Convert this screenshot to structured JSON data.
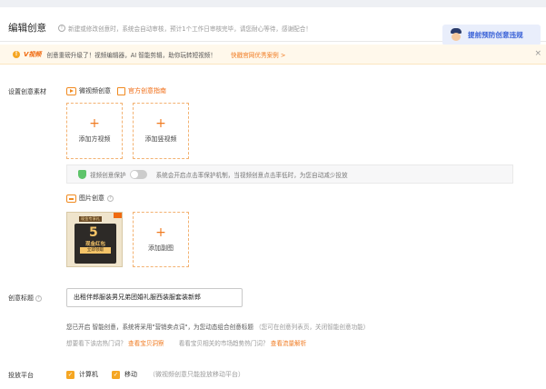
{
  "header": {
    "title": "编辑创意",
    "info_icon": "info-circle-icon",
    "info": "新建或修改创意时，系统会自动审核，预计1个工作日审核完毕，请您耐心等待，感谢配合！",
    "button_label": "提前预防创意违规",
    "button_icon": "police-avatar-icon"
  },
  "banner": {
    "icon": "warning-icon",
    "brand": "V视频",
    "text": "创意重磅升级了！视频编辑器，AI 智能剪辑，助你玩转短视频！",
    "link": "快戳官网优秀案例 >",
    "close": "×"
  },
  "creative_material": {
    "label": "设置创意素材",
    "video_tab": "微视频创意",
    "guide_link": "官方创意指南",
    "add_square_video": "添加方视频",
    "add_vertical_video": "添加竖视频",
    "protect_label": "视频创意保护",
    "protect_desc": "系统会开启点击率保护机制，当视频创意点击率低时，为您自动减少投放",
    "image_label": "图片创意",
    "thumb_tag": "现金专享礼",
    "thumb_number": "5",
    "thumb_title": "现金红包",
    "thumb_btn": "立即领取",
    "add_image": "添加副图"
  },
  "creative_title": {
    "label": "创意标题",
    "value": "出租伴郎服装男兄弟团婚礼服西装服套装新郎",
    "smart_note": "您已开启 智能创意，系统将采用\"营销卖点词\"，为您动态组合创意标题",
    "smart_hint": "（您可在创意列表页，关闭智能创意功能）",
    "hot_q1": "想要看下该店热门词？",
    "hot_link1": "查看宝贝洞察",
    "hot_q2": "看看宝贝相关的市场趋势热门词？",
    "hot_link2": "查看流量解析"
  },
  "platform": {
    "label": "投放平台",
    "option1": "计算机",
    "option2": "移动",
    "hint": "（微视频创意只能投放移动平台）"
  },
  "colors": {
    "accent": "#f07a20",
    "link_blue": "#3a62d7",
    "banner_bg": "#fff8eb"
  }
}
